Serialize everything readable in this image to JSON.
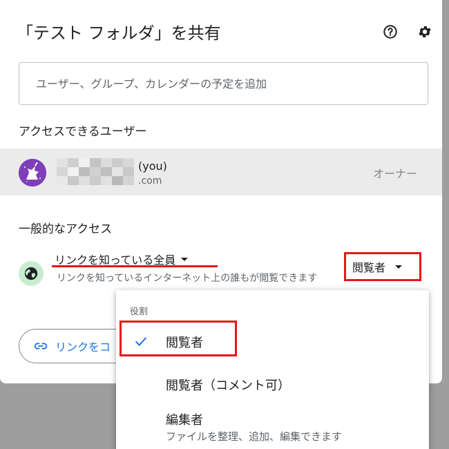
{
  "dialog": {
    "title": "「テスト フォルダ」を共有",
    "help_icon": "help-circle-icon",
    "settings_icon": "gear-icon"
  },
  "search": {
    "placeholder": "ユーザー、グループ、カレンダーの予定を追加"
  },
  "people_section": {
    "label": "アクセスできるユーザー",
    "users": [
      {
        "name_suffix": "(you)",
        "email_suffix": ".com",
        "role": "オーナー",
        "avatar_icon": "unicorn-avatar-icon"
      }
    ]
  },
  "general_access": {
    "label": "一般的なアクセス",
    "globe_icon": "globe-icon",
    "scope": "リンクを知っている全員",
    "description": "リンクを知っているインターネット上の誰もが閲覧できます",
    "role": "閲覧者",
    "copy_link_label": "リンクをコ"
  },
  "role_menu": {
    "header": "役割",
    "items": [
      {
        "label": "閲覧者",
        "selected": true,
        "sub": ""
      },
      {
        "label": "閲覧者（コメント可）",
        "selected": false,
        "sub": ""
      },
      {
        "label": "編集者",
        "selected": false,
        "sub": "ファイルを整理、追加、編集できます"
      }
    ]
  },
  "colors": {
    "highlight_red": "#e8141c",
    "link_blue": "#1a73e8",
    "avatar_purple": "#7e3fb8",
    "globe_bg": "#c8eccf"
  }
}
